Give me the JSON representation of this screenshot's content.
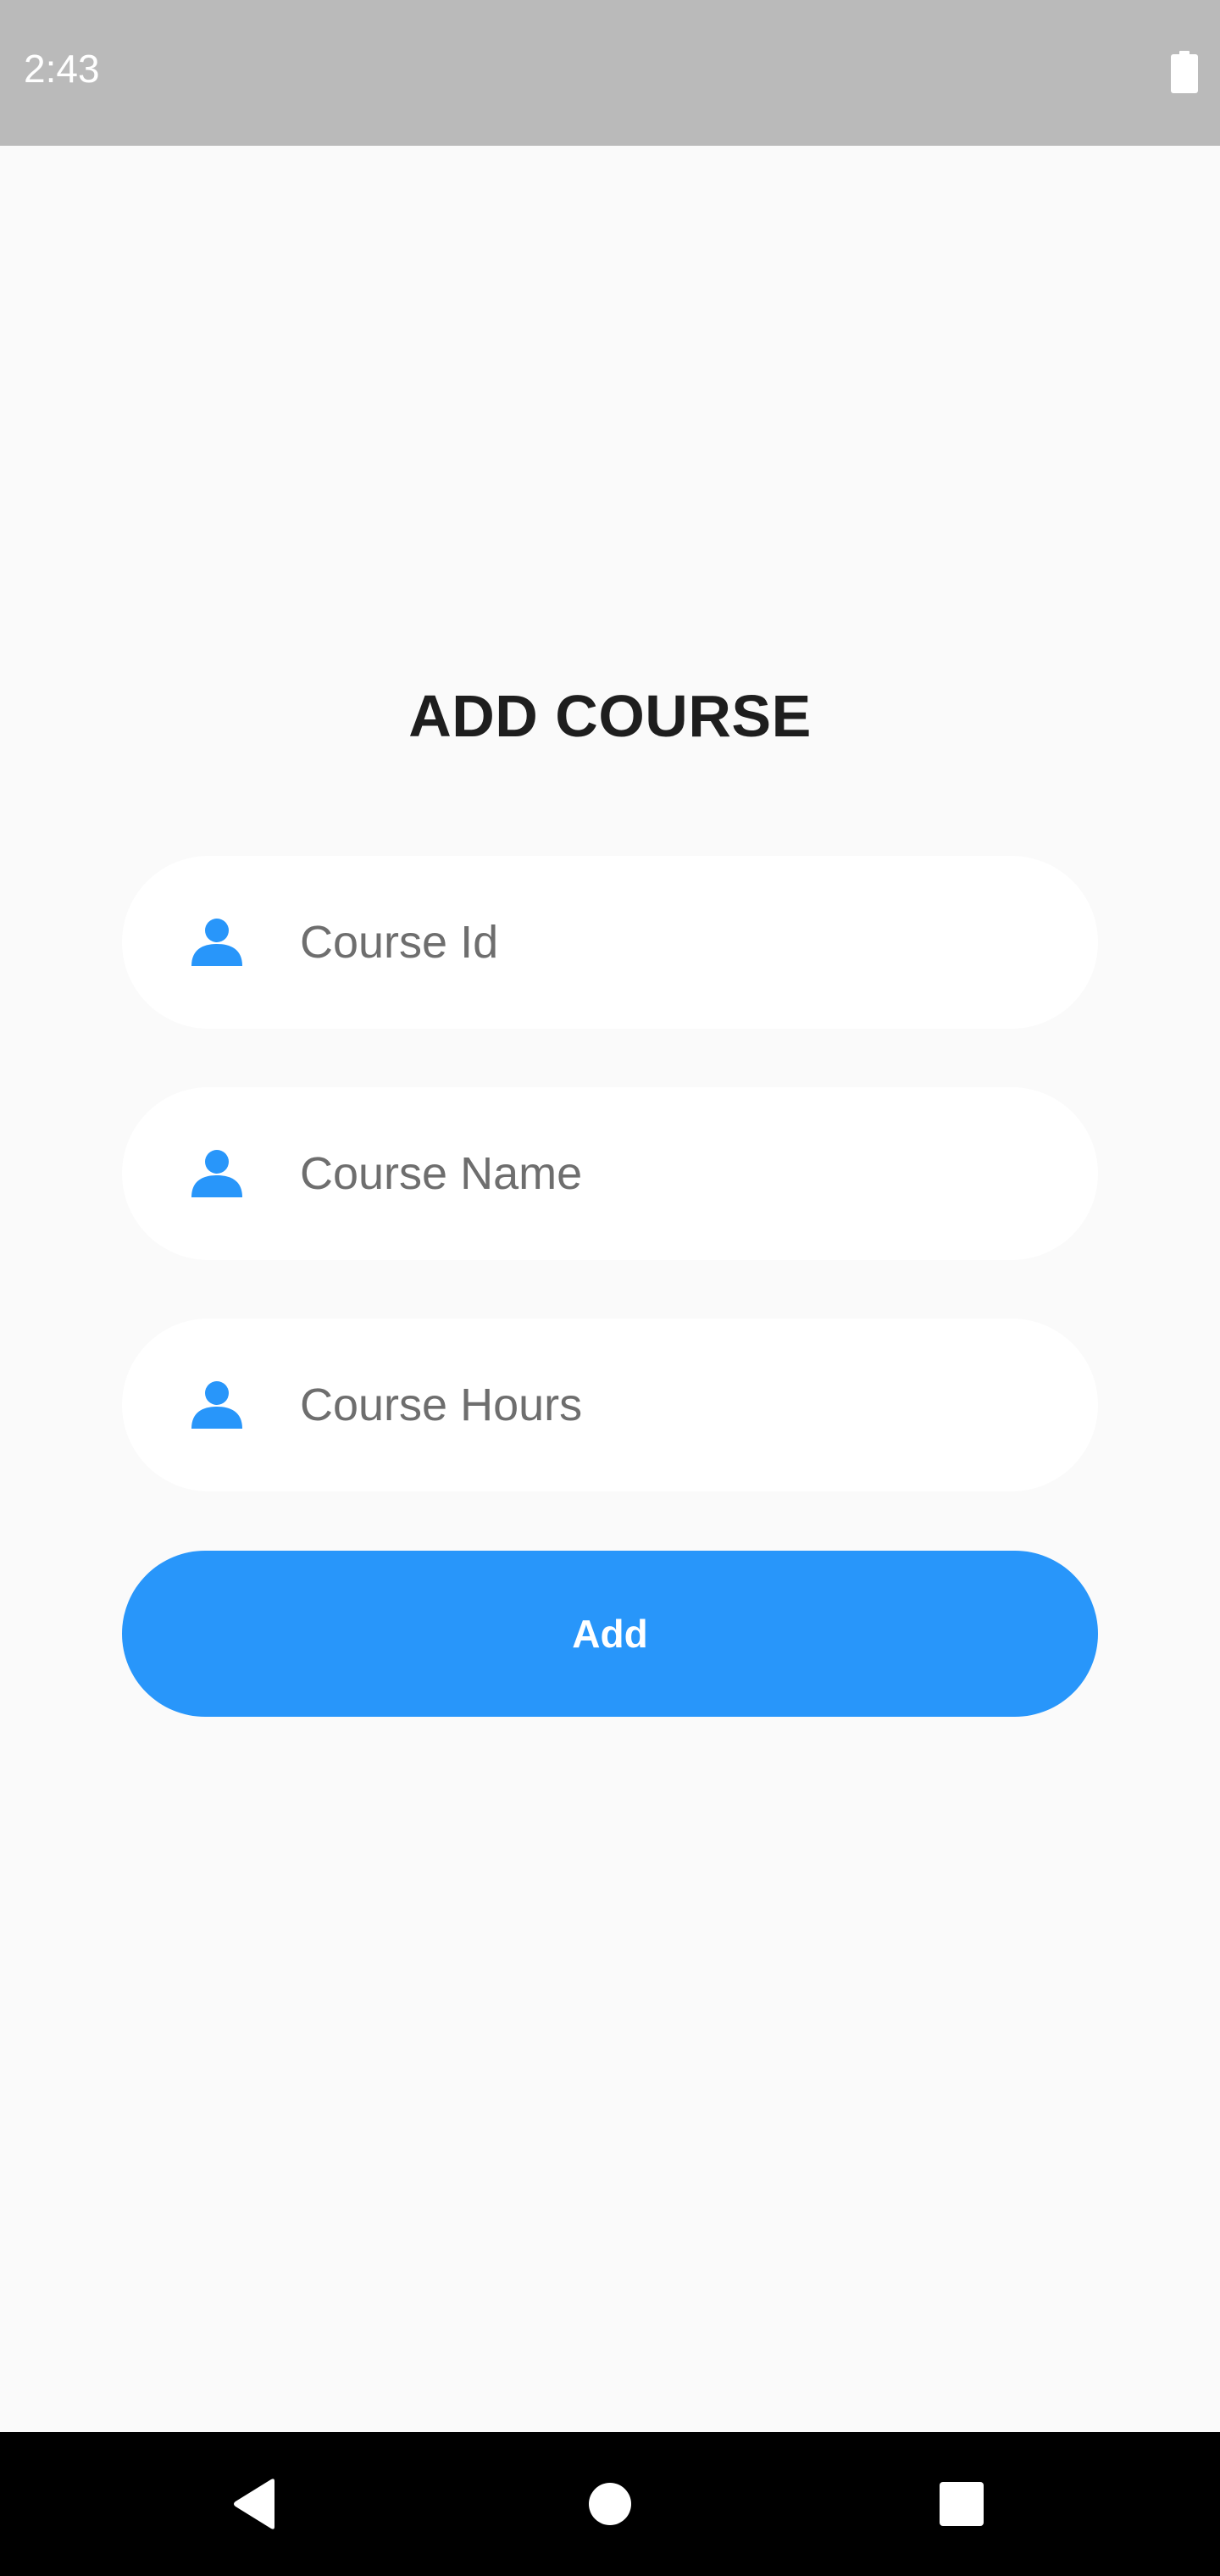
{
  "status_bar": {
    "time": "2:43",
    "battery_icon": "battery-full-icon"
  },
  "title": "ADD COURSE",
  "form": {
    "fields": [
      {
        "placeholder": "Course Id",
        "value": "",
        "icon": "person-icon"
      },
      {
        "placeholder": "Course Name",
        "value": "",
        "icon": "person-icon"
      },
      {
        "placeholder": "Course Hours",
        "value": "",
        "icon": "person-icon"
      }
    ],
    "submit_label": "Add"
  },
  "nav_bar": {
    "back_icon": "back-triangle-icon",
    "home_icon": "home-circle-icon",
    "recents_icon": "recents-square-icon"
  },
  "colors": {
    "accent": "#2896fa",
    "background": "#fafafa",
    "status_bar": "#bababa",
    "nav_bar": "#000000",
    "field_background": "#ffffff",
    "title_text": "#1e1e1e"
  }
}
